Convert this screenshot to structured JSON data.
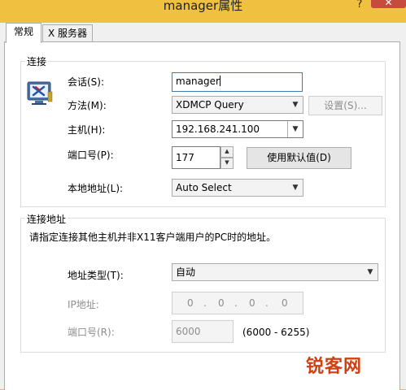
{
  "window": {
    "title": "manager属性",
    "help": "?",
    "close": "✕"
  },
  "tabs": [
    {
      "label": "常规"
    },
    {
      "label": "X 服务器"
    }
  ],
  "connection": {
    "legend": "连接",
    "icon": "xmanager-monitor-icon",
    "session_label": "会话(S):",
    "session_value": "manager",
    "method_label": "方法(M):",
    "method_value": "XDMCP Query",
    "settings_button": "设置(S)...",
    "host_label": "主机(H):",
    "host_value": "192.168.241.100",
    "port_label": "端口号(P):",
    "port_value": "177",
    "default_button": "使用默认值(D)",
    "local_label": "本地地址(L):",
    "local_value": "Auto Select"
  },
  "conn_address": {
    "legend": "连接地址",
    "description": "请指定连接其他主机并非X11客户端用户的PC时的地址。",
    "type_label": "地址类型(T):",
    "type_value": "自动",
    "ip_label": "IP地址:",
    "ip_octets": [
      "0",
      "0",
      "0",
      "0"
    ],
    "port_label": "端口号(R):",
    "port_value": "6000",
    "port_range": "(6000 - 6255)"
  },
  "watermark": {
    "part1": "锐客",
    "part2": "网"
  },
  "colors": {
    "title_bar": "#f0c040",
    "close_button": "#c74a3e",
    "focus_border": "#3c7fb1",
    "disabled_text": "#8d8d8d"
  }
}
